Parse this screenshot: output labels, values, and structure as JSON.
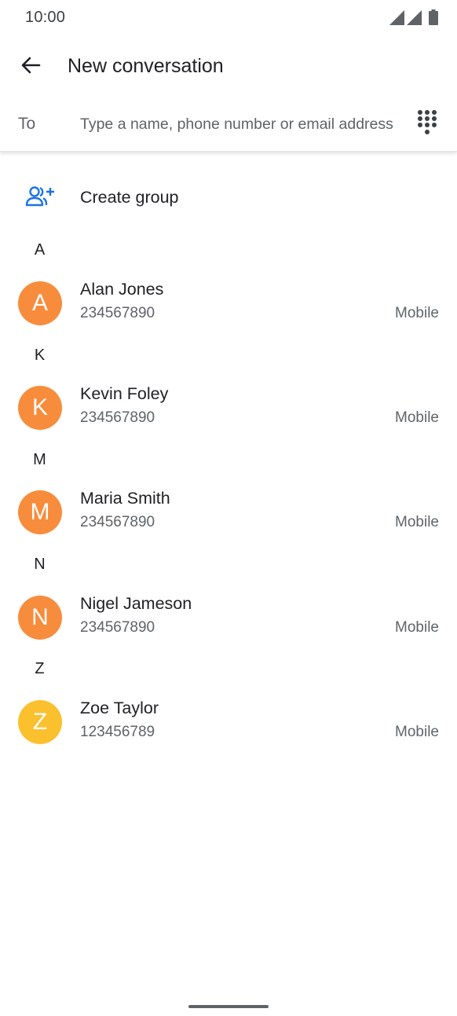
{
  "status_bar": {
    "time": "10:00",
    "icons": [
      "signal-icon",
      "signal-icon",
      "battery-icon"
    ]
  },
  "app_bar": {
    "back_icon": "arrow-back-icon",
    "title": "New conversation"
  },
  "to_field": {
    "label": "To",
    "placeholder": "Type a name, phone number or email address",
    "value": "",
    "dialpad_icon": "dialpad-icon"
  },
  "create_group": {
    "icon": "group-add-icon",
    "label": "Create group",
    "accent_color": "#1a73e8"
  },
  "contacts": {
    "sections": [
      {
        "letter": "A",
        "name": "Alan Jones",
        "number": "234567890",
        "type": "Mobile",
        "initial": "A",
        "avatar_color": "#f78d3c"
      },
      {
        "letter": "K",
        "name": "Kevin Foley",
        "number": "234567890",
        "type": "Mobile",
        "initial": "K",
        "avatar_color": "#f78d3c"
      },
      {
        "letter": "M",
        "name": "Maria Smith",
        "number": "234567890",
        "type": "Mobile",
        "initial": "M",
        "avatar_color": "#f78d3c"
      },
      {
        "letter": "N",
        "name": "Nigel Jameson",
        "number": "234567890",
        "type": "Mobile",
        "initial": "N",
        "avatar_color": "#f78d3c"
      },
      {
        "letter": "Z",
        "name": "Zoe Taylor",
        "number": "123456789",
        "type": "Mobile",
        "initial": "Z",
        "avatar_color": "#fbc02d"
      }
    ]
  }
}
